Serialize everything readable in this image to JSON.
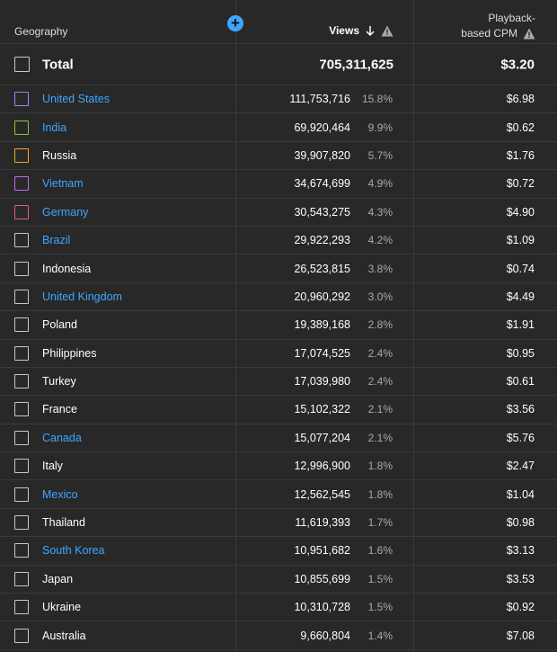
{
  "header": {
    "geography_label": "Geography",
    "views_label": "Views",
    "cpm_label_line1": "Playback-",
    "cpm_label_line2": "based CPM",
    "add_icon": "plus-circle-icon",
    "sort_icon": "arrow-down-icon",
    "warning_icon": "warning-triangle-icon"
  },
  "colors": {
    "background": "#282828",
    "link": "#3ea6ff",
    "accent_button": "#3ea6ff",
    "divider": "#3a3a3a"
  },
  "total": {
    "label": "Total",
    "views": "705,311,625",
    "cpm": "$3.20"
  },
  "rows": [
    {
      "country": "United States",
      "views": "111,753,716",
      "pct": "15.8%",
      "cpm": "$6.98",
      "link": true,
      "checkbox_color": "#8c8cff"
    },
    {
      "country": "India",
      "views": "69,920,464",
      "pct": "9.9%",
      "cpm": "$0.62",
      "link": true,
      "checkbox_color": "#8bc34a"
    },
    {
      "country": "Russia",
      "views": "39,907,820",
      "pct": "5.7%",
      "cpm": "$1.76",
      "link": false,
      "checkbox_color": "#f5a623"
    },
    {
      "country": "Vietnam",
      "views": "34,674,699",
      "pct": "4.9%",
      "cpm": "$0.72",
      "link": true,
      "checkbox_color": "#b66cf0"
    },
    {
      "country": "Germany",
      "views": "30,543,275",
      "pct": "4.3%",
      "cpm": "$4.90",
      "link": true,
      "checkbox_color": "#e35d7a"
    },
    {
      "country": "Brazil",
      "views": "29,922,293",
      "pct": "4.2%",
      "cpm": "$1.09",
      "link": true,
      "checkbox_color": "#c8c8c8"
    },
    {
      "country": "Indonesia",
      "views": "26,523,815",
      "pct": "3.8%",
      "cpm": "$0.74",
      "link": false,
      "checkbox_color": "#c8c8c8"
    },
    {
      "country": "United Kingdom",
      "views": "20,960,292",
      "pct": "3.0%",
      "cpm": "$4.49",
      "link": true,
      "checkbox_color": "#c8c8c8"
    },
    {
      "country": "Poland",
      "views": "19,389,168",
      "pct": "2.8%",
      "cpm": "$1.91",
      "link": false,
      "checkbox_color": "#c8c8c8"
    },
    {
      "country": "Philippines",
      "views": "17,074,525",
      "pct": "2.4%",
      "cpm": "$0.95",
      "link": false,
      "checkbox_color": "#c8c8c8"
    },
    {
      "country": "Turkey",
      "views": "17,039,980",
      "pct": "2.4%",
      "cpm": "$0.61",
      "link": false,
      "checkbox_color": "#c8c8c8"
    },
    {
      "country": "France",
      "views": "15,102,322",
      "pct": "2.1%",
      "cpm": "$3.56",
      "link": false,
      "checkbox_color": "#c8c8c8"
    },
    {
      "country": "Canada",
      "views": "15,077,204",
      "pct": "2.1%",
      "cpm": "$5.76",
      "link": true,
      "checkbox_color": "#c8c8c8"
    },
    {
      "country": "Italy",
      "views": "12,996,900",
      "pct": "1.8%",
      "cpm": "$2.47",
      "link": false,
      "checkbox_color": "#c8c8c8"
    },
    {
      "country": "Mexico",
      "views": "12,562,545",
      "pct": "1.8%",
      "cpm": "$1.04",
      "link": true,
      "checkbox_color": "#c8c8c8"
    },
    {
      "country": "Thailand",
      "views": "11,619,393",
      "pct": "1.7%",
      "cpm": "$0.98",
      "link": false,
      "checkbox_color": "#c8c8c8"
    },
    {
      "country": "South Korea",
      "views": "10,951,682",
      "pct": "1.6%",
      "cpm": "$3.13",
      "link": true,
      "checkbox_color": "#c8c8c8"
    },
    {
      "country": "Japan",
      "views": "10,855,699",
      "pct": "1.5%",
      "cpm": "$3.53",
      "link": false,
      "checkbox_color": "#c8c8c8"
    },
    {
      "country": "Ukraine",
      "views": "10,310,728",
      "pct": "1.5%",
      "cpm": "$0.92",
      "link": false,
      "checkbox_color": "#c8c8c8"
    },
    {
      "country": "Australia",
      "views": "9,660,804",
      "pct": "1.4%",
      "cpm": "$7.08",
      "link": false,
      "checkbox_color": "#c8c8c8"
    }
  ]
}
